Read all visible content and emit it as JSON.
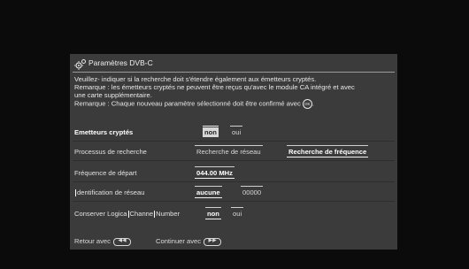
{
  "window": {
    "title": "Paramètres DVB-C",
    "icon": "gear-icon"
  },
  "info": {
    "line1": "Veuillez- indiquer si la recherche doit s'étendre également  aux émetteurs cryptés.",
    "line2": "Remarque : les émetteurs cryptés ne peuvent être reçus qu'avec le module CA intégré et avec",
    "line3": "une carte supplémentaire.",
    "line4": "Remarque : Chaque nouveau paramètre sélectionné doit être confirmé avec",
    "ok_glyph": "OK"
  },
  "rows": {
    "encrypted": {
      "label": "Emetteurs cryptés",
      "options": [
        "non",
        "oui"
      ],
      "selected": "non"
    },
    "search_process": {
      "label": "Processus de recherche",
      "options": [
        "Recherche de réseau",
        "Recherche de fréquence"
      ],
      "selected": "Recherche de fréquence"
    },
    "start_frequency": {
      "label": "Fréquence de départ",
      "value": "044.00 MHz"
    },
    "network_id": {
      "label_a": "dentification de réseau",
      "options": [
        "aucune",
        "00000"
      ],
      "selected": "aucune"
    },
    "lcn": {
      "label_a": "Conserver Logica",
      "label_b": "Channe",
      "label_c": "Number",
      "options": [
        "non",
        "oui"
      ],
      "selected": "non"
    }
  },
  "footer": {
    "back_label": "Retour avec",
    "back_key": "◀◀",
    "continue_label": "Continuer avec",
    "continue_key": "▶▶"
  }
}
